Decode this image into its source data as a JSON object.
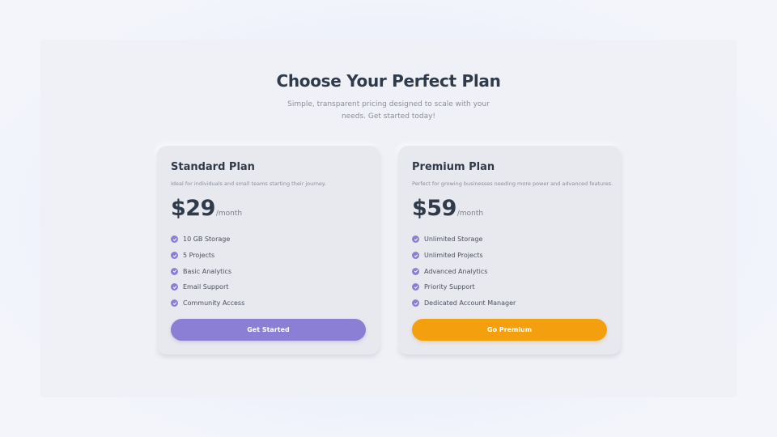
{
  "header": {
    "title": "Choose Your Perfect Plan",
    "subtitle": "Simple, transparent pricing designed to scale with your needs. Get started today!"
  },
  "plans": [
    {
      "name": "Standard Plan",
      "description": "Ideal for individuals and small teams starting their journey.",
      "price": "$29",
      "period": "/month",
      "features": [
        "10 GB Storage",
        "5 Projects",
        "Basic Analytics",
        "Email Support",
        "Community Access"
      ],
      "cta": "Get Started",
      "cta_color": "#8a7fd4"
    },
    {
      "name": "Premium Plan",
      "description": "Perfect for growing businesses needing more power and advanced features.",
      "price": "$59",
      "period": "/month",
      "features": [
        "Unlimited Storage",
        "Unlimited Projects",
        "Advanced Analytics",
        "Priority Support",
        "Dedicated Account Manager"
      ],
      "cta": "Go Premium",
      "cta_color": "#f4a00e"
    }
  ],
  "colors": {
    "accent": "#8a7fd4",
    "premium_accent": "#f4a00e",
    "heading": "#2f3a4a"
  },
  "icons": {
    "feature_check": "check-circle-icon"
  }
}
